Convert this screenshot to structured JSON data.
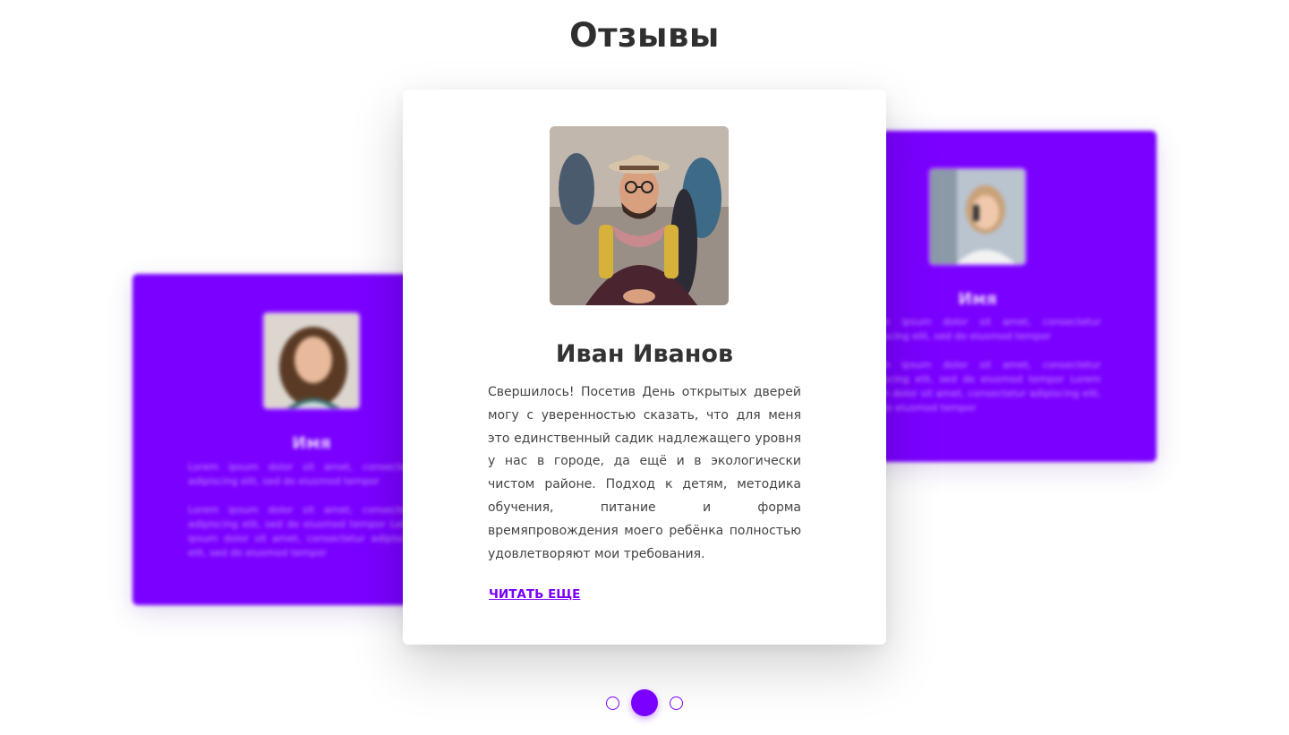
{
  "section": {
    "title": "Отзывы"
  },
  "main_card": {
    "name": "Иван Иванов",
    "text": "Свершилось! Посетив День открытых дверей могу с уверенностью сказать, что для меня это единственный садик надлежащего уровня у нас в городе, да ещё и в экологически чистом районе. Подход к детям, методика обучения, питание и форма времяпровождения моего ребёнка полностью удовлетворяют мои требования.",
    "read_more": "ЧИТАТЬ ЕЩЕ"
  },
  "side_cards": [
    {
      "name": "Имя",
      "text": "Lorem ipsum dolor sit amet, consectetur adipiscing elit, sed do eiusmod tempor\n\nLorem ipsum dolor sit amet, consectetur adipiscing elit, sed do eiusmod tempor Lorem ipsum dolor sit amet, consectetur adipiscing elit, sed do eiusmod tempor"
    },
    {
      "name": "Имя",
      "text": "Lorem ipsum dolor sit amet, consectetur adipiscing elit, sed do eiusmod tempor\n\nLorem ipsum dolor sit amet, consectetur adipiscing elit, sed do eiusmod tempor Lorem ipsum dolor sit amet, consectetur adipiscing elit, sed do eiusmod tempor"
    }
  ],
  "pagination": {
    "total": 3,
    "active": 2
  },
  "colors": {
    "accent": "#7a00ff",
    "text": "#333333",
    "background": "#ffffff"
  },
  "icons": {
    "main_avatar": "man-with-hat-photo",
    "left_avatar": "woman-curly-hair-photo",
    "right_avatar": "woman-on-phone-photo"
  }
}
